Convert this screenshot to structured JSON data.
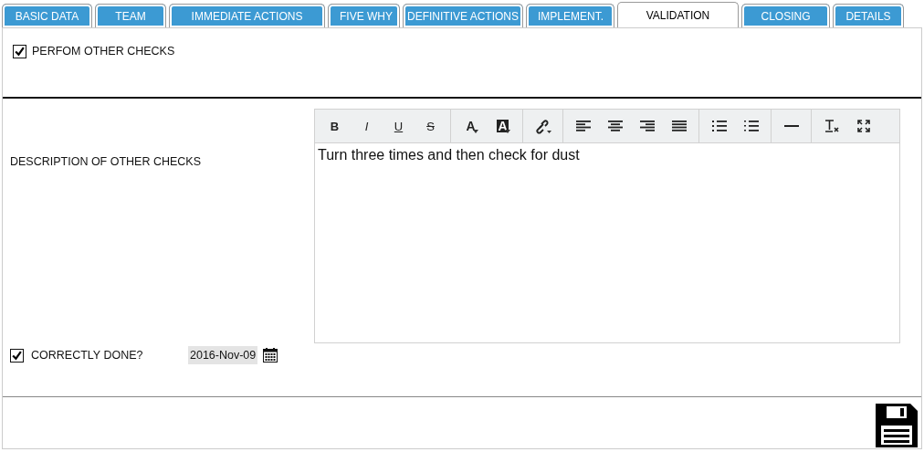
{
  "tabs": [
    {
      "label": "BASIC DATA",
      "selected": false
    },
    {
      "label": "TEAM",
      "selected": false
    },
    {
      "label": "IMMEDIATE ACTIONS",
      "selected": false
    },
    {
      "label": "FIVE WHY",
      "selected": false
    },
    {
      "label": "DEFINITIVE ACTIONS",
      "selected": false
    },
    {
      "label": "IMPLEMENT.",
      "selected": false
    },
    {
      "label": "VALIDATION",
      "selected": true
    },
    {
      "label": "CLOSING",
      "selected": false
    },
    {
      "label": "DETAILS",
      "selected": false
    }
  ],
  "perform_checks": {
    "label": "PERFOM OTHER CHECKS",
    "checked": true
  },
  "description": {
    "label": "DESCRIPTION OF OTHER CHECKS",
    "value": "Turn three times and then check for dust",
    "toolbar": [
      [
        {
          "kind": "bold",
          "label": "B"
        },
        {
          "kind": "italic",
          "label": "I"
        },
        {
          "kind": "underline",
          "label": "U"
        },
        {
          "kind": "strike",
          "label": "S"
        }
      ],
      [
        {
          "kind": "text-color",
          "label": "A"
        },
        {
          "kind": "background-color",
          "label": "A"
        }
      ],
      [
        {
          "kind": "link"
        }
      ],
      [
        {
          "kind": "align-left"
        },
        {
          "kind": "align-center"
        },
        {
          "kind": "align-right"
        },
        {
          "kind": "justify"
        }
      ],
      [
        {
          "kind": "bullet-list"
        },
        {
          "kind": "numbered-list"
        }
      ],
      [
        {
          "kind": "horizontal-rule"
        }
      ],
      [
        {
          "kind": "clear-format"
        },
        {
          "kind": "fullscreen"
        }
      ]
    ]
  },
  "correctly_done": {
    "label": "CORRECTLY DONE?",
    "checked": true,
    "date": "2016-Nov-09"
  }
}
